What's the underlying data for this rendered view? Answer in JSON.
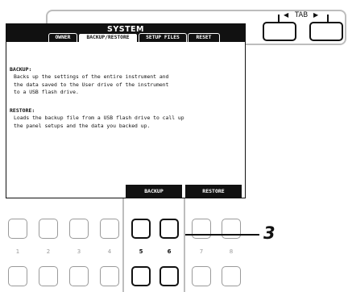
{
  "screen": {
    "title": "SYSTEM",
    "tabs": [
      "OWNER",
      "BACKUP/RESTORE",
      "SETUP FILES",
      "RESET"
    ],
    "backup_heading": "BACKUP:",
    "backup_lines": [
      "Backs up the settings of the entire instrument and",
      "the data saved to the User drive of the instrument",
      "to a USB flash drive."
    ],
    "restore_heading": "RESTORE:",
    "restore_lines": [
      "Loads the backup file from a USB flash drive to call up",
      "the panel setups and the data you backed up."
    ],
    "backup_button": "BACKUP",
    "restore_button": "RESTORE"
  },
  "tab_control": {
    "label": "TAB",
    "left_arrow": "◀",
    "right_arrow": "▶"
  },
  "panel_buttons": {
    "numbers": [
      "1",
      "2",
      "3",
      "4",
      "5",
      "6",
      "7",
      "8"
    ]
  },
  "step_number": "3"
}
